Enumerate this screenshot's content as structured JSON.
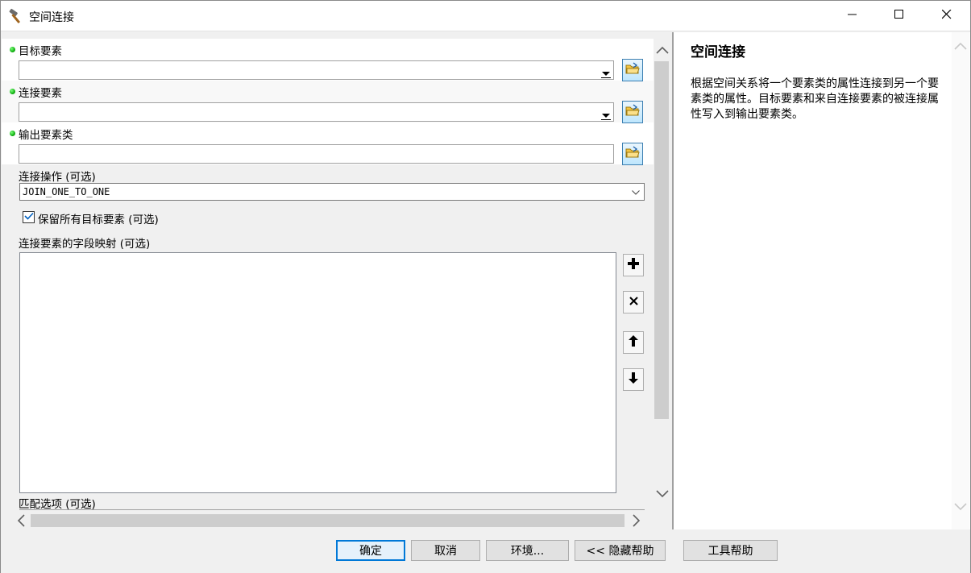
{
  "window": {
    "title": "空间连接",
    "icon": "hammer-icon",
    "controls": [
      "minimize-icon",
      "maximize-icon",
      "close-icon"
    ]
  },
  "params": {
    "target": {
      "label": "目标要素",
      "value": "",
      "required": true
    },
    "join": {
      "label": "连接要素",
      "value": "",
      "required": true
    },
    "output": {
      "label": "输出要素类",
      "value": "",
      "required": true
    },
    "operation": {
      "label": "连接操作 (可选)",
      "value": "JOIN_ONE_TO_ONE"
    },
    "keep_all": {
      "label": "保留所有目标要素 (可选)",
      "checked": true
    },
    "field_map": {
      "label": "连接要素的字段映射 (可选)"
    },
    "match": {
      "label": "匹配选项 (可选)"
    }
  },
  "field_map_tools": [
    "add-icon",
    "remove-icon",
    "move-up-icon",
    "move-down-icon"
  ],
  "help": {
    "title": "空间连接",
    "text": "根据空间关系将一个要素类的属性连接到另一个要素类的属性。目标要素和来自连接要素的被连接属性写入到输出要素类。"
  },
  "buttons": {
    "ok": "确定",
    "cancel": "取消",
    "env": "环境...",
    "hide_help": "<< 隐藏帮助",
    "tool_help": "工具帮助"
  },
  "colors": {
    "accent": "#0078d7",
    "required_dot": "#10b010",
    "browse_button": "#bee6fd"
  }
}
